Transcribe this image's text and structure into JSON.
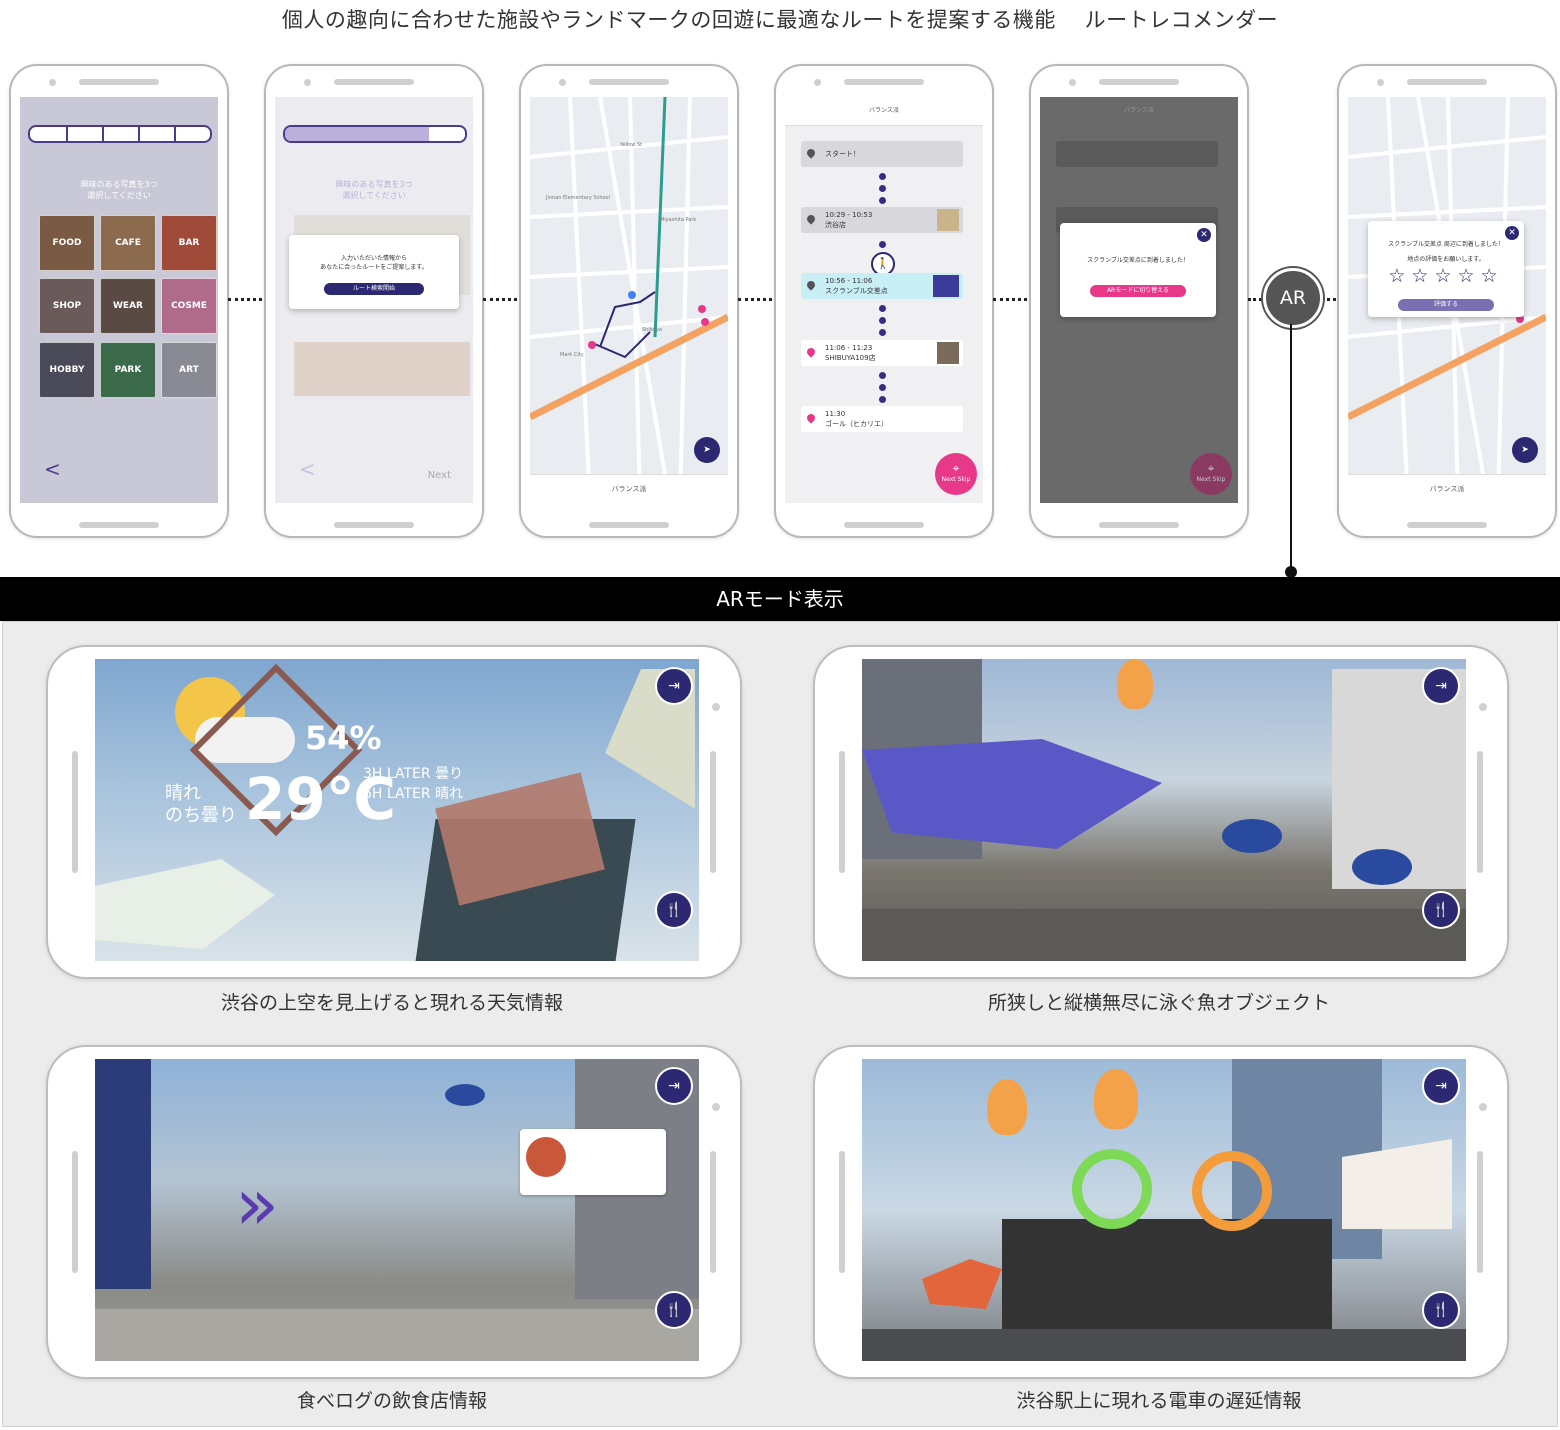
{
  "title": "個人の趣向に合わせた施設やランドマークの回遊に最適なルートを提案する機能　 ルートレコメンダー",
  "phones": {
    "p1": {
      "prompt_line1": "興味のある写真を3つ",
      "prompt_line2": "選択してください",
      "categories": [
        "FOOD",
        "CAFE",
        "BAR",
        "SHOP",
        "WEAR",
        "COSME",
        "HOBBY",
        "PARK",
        "ART"
      ],
      "back": "<"
    },
    "p2": {
      "prompt_line1": "興味のある写真を3つ",
      "prompt_line2": "選択してください",
      "modal_line1": "入力いただいた情報から",
      "modal_line2": "あなたに合ったルートをご提案します。",
      "modal_button": "ルート検索開始",
      "back": "<",
      "next": "Next"
    },
    "p3": {
      "bottom": "バランス派",
      "map_labels": [
        "Yellow St",
        "Shibuya",
        "Miyashita Park",
        "Mark City",
        "Jinnan Elementary School"
      ]
    },
    "p4": {
      "header": "バランス派",
      "stops": [
        {
          "time": "",
          "name": "スタート！"
        },
        {
          "time": "10:29 - 10:53",
          "name": "渋谷店"
        },
        {
          "time": "10:56 - 11:06",
          "name": "スクランブル交差点"
        },
        {
          "time": "11:06 - 11:23",
          "name": "SHIBUYA109店"
        },
        {
          "time": "11:30",
          "name": "ゴール（ヒカリエ）"
        }
      ],
      "next_skip": "Next Skip",
      "bottom": "バランス派"
    },
    "p5": {
      "header": "バランス派",
      "modal_text": "スクランブル交差点に到着しました！",
      "modal_button": "ARモードに切り替える",
      "next_skip": "Next Skip"
    },
    "p6": {
      "modal_line1": "スクランブル交差点 周辺に到着しました！",
      "modal_line2": "地点の評価をお願いします。",
      "stars": 5,
      "modal_button": "評価する",
      "bottom": "バランス派"
    }
  },
  "ar_label": "AR",
  "ar_section_title": "ARモード表示",
  "ar_screens": [
    {
      "caption": "渋谷の上空を見上げると現れる天気情報",
      "humidity": "54%",
      "weather": "晴れ",
      "weather2": "のち曇り",
      "temperature": "29℃",
      "forecast1": "3H LATER 曇り",
      "forecast2": "6H LATER 晴れ"
    },
    {
      "caption": "所狭しと縦横無尽に泳ぐ魚オブジェクト"
    },
    {
      "caption": "食べログの飲食店情報"
    },
    {
      "caption": "渋谷駅上に現れる電車の遅延情報"
    }
  ],
  "colors": {
    "accent": "#2d2872",
    "pink": "#e8388a",
    "purple_light": "#b9b0dc"
  }
}
